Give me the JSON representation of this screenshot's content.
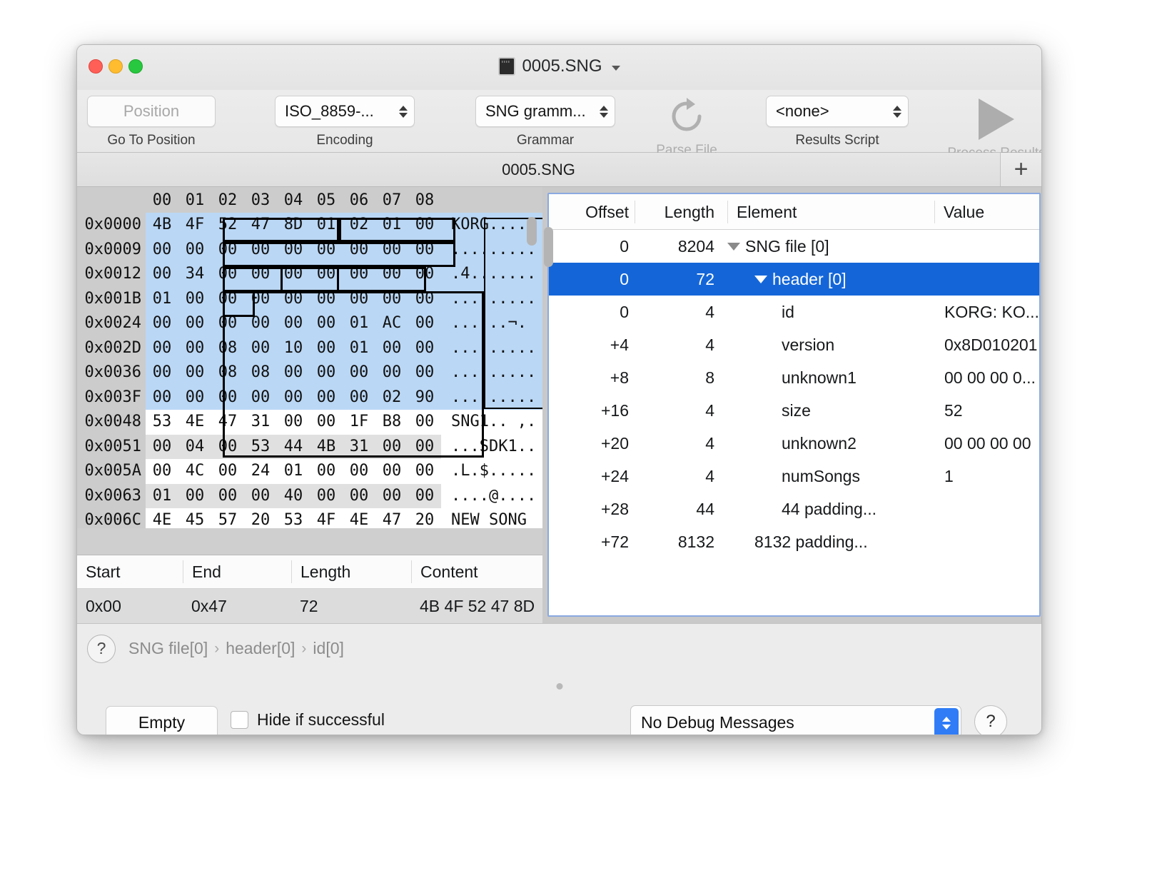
{
  "window": {
    "title": "0005.SNG",
    "doc_icon": "document-icon",
    "traffic_lights": [
      "close",
      "minimize",
      "zoom"
    ]
  },
  "toolbar": {
    "position_placeholder": "Position",
    "position_label": "Go To Position",
    "encoding_value": "ISO_8859-...",
    "encoding_label": "Encoding",
    "grammar_value": "SNG gramm...",
    "grammar_label": "Grammar",
    "parse_label": "Parse File",
    "parse_icon": "refresh-icon",
    "results_script_value": "<none>",
    "results_script_label": "Results Script",
    "process_label": "Process Results",
    "process_icon": "play-icon"
  },
  "tabbar": {
    "tab_label": "0005.SNG",
    "add_label": "+"
  },
  "hex": {
    "column_headers": [
      "00",
      "01",
      "02",
      "03",
      "04",
      "05",
      "06",
      "07",
      "08"
    ],
    "rows": [
      {
        "offset": "0x0000",
        "bytes": [
          "4B",
          "4F",
          "52",
          "47",
          "8D",
          "01",
          "02",
          "01",
          "00"
        ],
        "ascii": "KORG.....",
        "state": "selected"
      },
      {
        "offset": "0x0009",
        "bytes": [
          "00",
          "00",
          "00",
          "00",
          "00",
          "00",
          "00",
          "00",
          "00"
        ],
        "ascii": ".........",
        "state": "selected"
      },
      {
        "offset": "0x0012",
        "bytes": [
          "00",
          "34",
          "00",
          "00",
          "00",
          "00",
          "00",
          "00",
          "00"
        ],
        "ascii": ".4.......",
        "state": "selected"
      },
      {
        "offset": "0x001B",
        "bytes": [
          "01",
          "00",
          "00",
          "00",
          "00",
          "00",
          "00",
          "00",
          "00"
        ],
        "ascii": ".........",
        "state": "selected"
      },
      {
        "offset": "0x0024",
        "bytes": [
          "00",
          "00",
          "00",
          "00",
          "00",
          "00",
          "01",
          "AC",
          "00"
        ],
        "ascii": "......¬.",
        "state": "selected"
      },
      {
        "offset": "0x002D",
        "bytes": [
          "00",
          "00",
          "08",
          "00",
          "10",
          "00",
          "01",
          "00",
          "00"
        ],
        "ascii": ".........",
        "state": "selected"
      },
      {
        "offset": "0x0036",
        "bytes": [
          "00",
          "00",
          "08",
          "08",
          "00",
          "00",
          "00",
          "00",
          "00"
        ],
        "ascii": ".........",
        "state": "selected"
      },
      {
        "offset": "0x003F",
        "bytes": [
          "00",
          "00",
          "00",
          "00",
          "00",
          "00",
          "00",
          "02",
          "90"
        ],
        "ascii": ".........",
        "state": "selected"
      },
      {
        "offset": "0x0048",
        "bytes": [
          "53",
          "4E",
          "47",
          "31",
          "00",
          "00",
          "1F",
          "B8",
          "00"
        ],
        "ascii": "SNG1.. ,.",
        "state": "plain"
      },
      {
        "offset": "0x0051",
        "bytes": [
          "00",
          "04",
          "00",
          "53",
          "44",
          "4B",
          "31",
          "00",
          "00"
        ],
        "ascii": "...SDK1..",
        "state": "alt"
      },
      {
        "offset": "0x005A",
        "bytes": [
          "00",
          "4C",
          "00",
          "24",
          "01",
          "00",
          "00",
          "00",
          "00"
        ],
        "ascii": ".L.$.....",
        "state": "plain"
      },
      {
        "offset": "0x0063",
        "bytes": [
          "01",
          "00",
          "00",
          "00",
          "40",
          "00",
          "00",
          "00",
          "00"
        ],
        "ascii": "....@....",
        "state": "alt"
      },
      {
        "offset": "0x006C",
        "bytes": [
          "4E",
          "45",
          "57",
          "20",
          "53",
          "4F",
          "4E",
          "47",
          "20"
        ],
        "ascii": "NEW SONG ",
        "state": "plain"
      }
    ]
  },
  "range_table": {
    "headers": [
      "Start",
      "End",
      "Length",
      "Content"
    ],
    "rows": [
      {
        "start": "0x00",
        "end": "0x47",
        "length": "72",
        "content": "4B 4F 52 47 8D"
      }
    ]
  },
  "results": {
    "headers": [
      "Offset",
      "Length",
      "Element",
      "Value"
    ],
    "rows": [
      {
        "offset": "0",
        "length": "8204",
        "element": "SNG file [0]",
        "value": "",
        "indent": 0,
        "disclosure": true,
        "selected": false
      },
      {
        "offset": "0",
        "length": "72",
        "element": "header [0]",
        "value": "",
        "indent": 1,
        "disclosure": true,
        "selected": true
      },
      {
        "offset": "0",
        "length": "4",
        "element": "id",
        "value": "KORG: KO...",
        "indent": 2,
        "disclosure": false,
        "selected": false
      },
      {
        "offset": "+4",
        "length": "4",
        "element": "version",
        "value": "0x8D010201",
        "indent": 2,
        "disclosure": false,
        "selected": false
      },
      {
        "offset": "+8",
        "length": "8",
        "element": "unknown1",
        "value": "00 00 00 0...",
        "indent": 2,
        "disclosure": false,
        "selected": false
      },
      {
        "offset": "+16",
        "length": "4",
        "element": "size",
        "value": "52",
        "indent": 2,
        "disclosure": false,
        "selected": false
      },
      {
        "offset": "+20",
        "length": "4",
        "element": "unknown2",
        "value": "00 00 00 00",
        "indent": 2,
        "disclosure": false,
        "selected": false
      },
      {
        "offset": "+24",
        "length": "4",
        "element": "numSongs",
        "value": "1",
        "indent": 2,
        "disclosure": false,
        "selected": false
      },
      {
        "offset": "+28",
        "length": "44",
        "element": "44 padding...",
        "value": "",
        "indent": 2,
        "disclosure": false,
        "selected": false
      },
      {
        "offset": "+72",
        "length": "8132",
        "element": "8132 padding...",
        "value": "",
        "indent": 1,
        "disclosure": false,
        "selected": false
      }
    ]
  },
  "breadcrumb": {
    "help_label": "?",
    "items": [
      "SNG file[0]",
      "header[0]",
      "id[0]"
    ],
    "separator": "›"
  },
  "bottombar": {
    "empty_label": "Empty",
    "hide_if_successful_label": "Hide if successful",
    "hide_if_successful_checked": false,
    "debug_value": "No Debug Messages",
    "help_label": "?"
  },
  "colors": {
    "selection_blue": "#1466d8",
    "hex_selection": "#bad7f5",
    "stepper_blue": "#2f7cf6",
    "window_chrome": "#ececec"
  }
}
